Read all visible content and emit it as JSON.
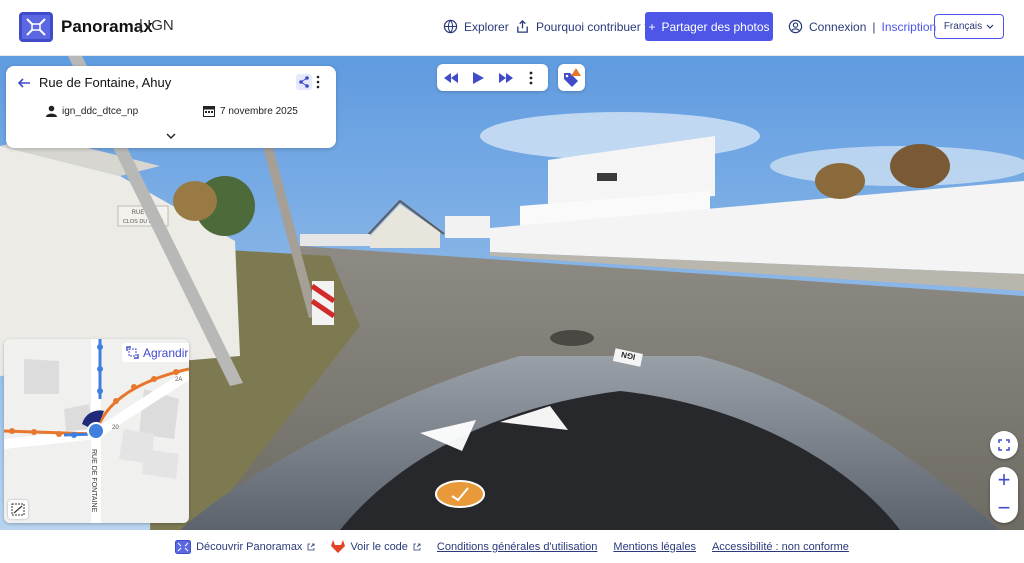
{
  "header": {
    "brand": "Panoramax",
    "brand_suffix": "| IGN",
    "nav": {
      "explorer": "Explorer",
      "why_contribute": "Pourquoi contribuer ?",
      "share_photos": "Partager des photos",
      "login": "Connexion",
      "separator": "|",
      "signup": "Inscription",
      "language": "Français"
    }
  },
  "info_panel": {
    "title": "Rue de Fontaine, Ahuy",
    "author": "ign_ddc_dtce_np",
    "date": "7 novembre 2025"
  },
  "minimap": {
    "expand_label": "Agrandir",
    "street_label": "RUE DE FONTAINE",
    "house_number": "2A",
    "house_number_2": "20"
  },
  "photo": {
    "sign_text_line1": "RUE DE",
    "sign_text_line2": "CLOS DU BEZE",
    "car_sticker": "IGN"
  },
  "zoom": {
    "in": "+",
    "out": "−"
  },
  "footer": {
    "discover": "Découvrir Panoramax",
    "view_code": "Voir le code",
    "terms": "Conditions générales d'utilisation",
    "legal": "Mentions légales",
    "accessibility": "Accessibilité : non conforme"
  },
  "colors": {
    "accent": "#4e56e8",
    "map_orange": "#e8772e",
    "map_blue": "#3f7fe0"
  }
}
